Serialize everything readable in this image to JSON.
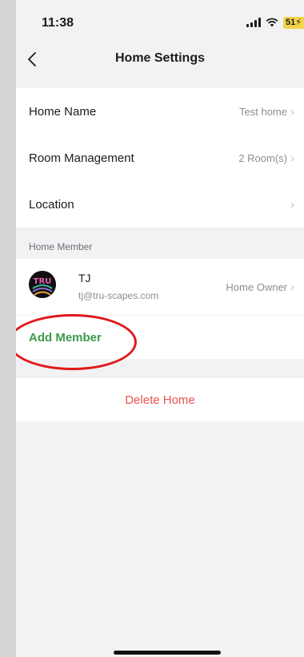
{
  "status_bar": {
    "time": "11:38",
    "battery": "51"
  },
  "header": {
    "title": "Home Settings"
  },
  "settings": [
    {
      "label": "Home Name",
      "value": "Test home"
    },
    {
      "label": "Room Management",
      "value": "2 Room(s)"
    },
    {
      "label": "Location",
      "value": ""
    }
  ],
  "members_section": {
    "title": "Home Member",
    "members": [
      {
        "name": "TJ",
        "email": "tj@tru-scapes.com",
        "role": "Home Owner",
        "avatar_text": "TRU"
      }
    ],
    "add_label": "Add Member"
  },
  "delete_label": "Delete Home",
  "colors": {
    "add": "#3c9a4b",
    "delete": "#e8524f",
    "annotation": "#e0191b"
  }
}
